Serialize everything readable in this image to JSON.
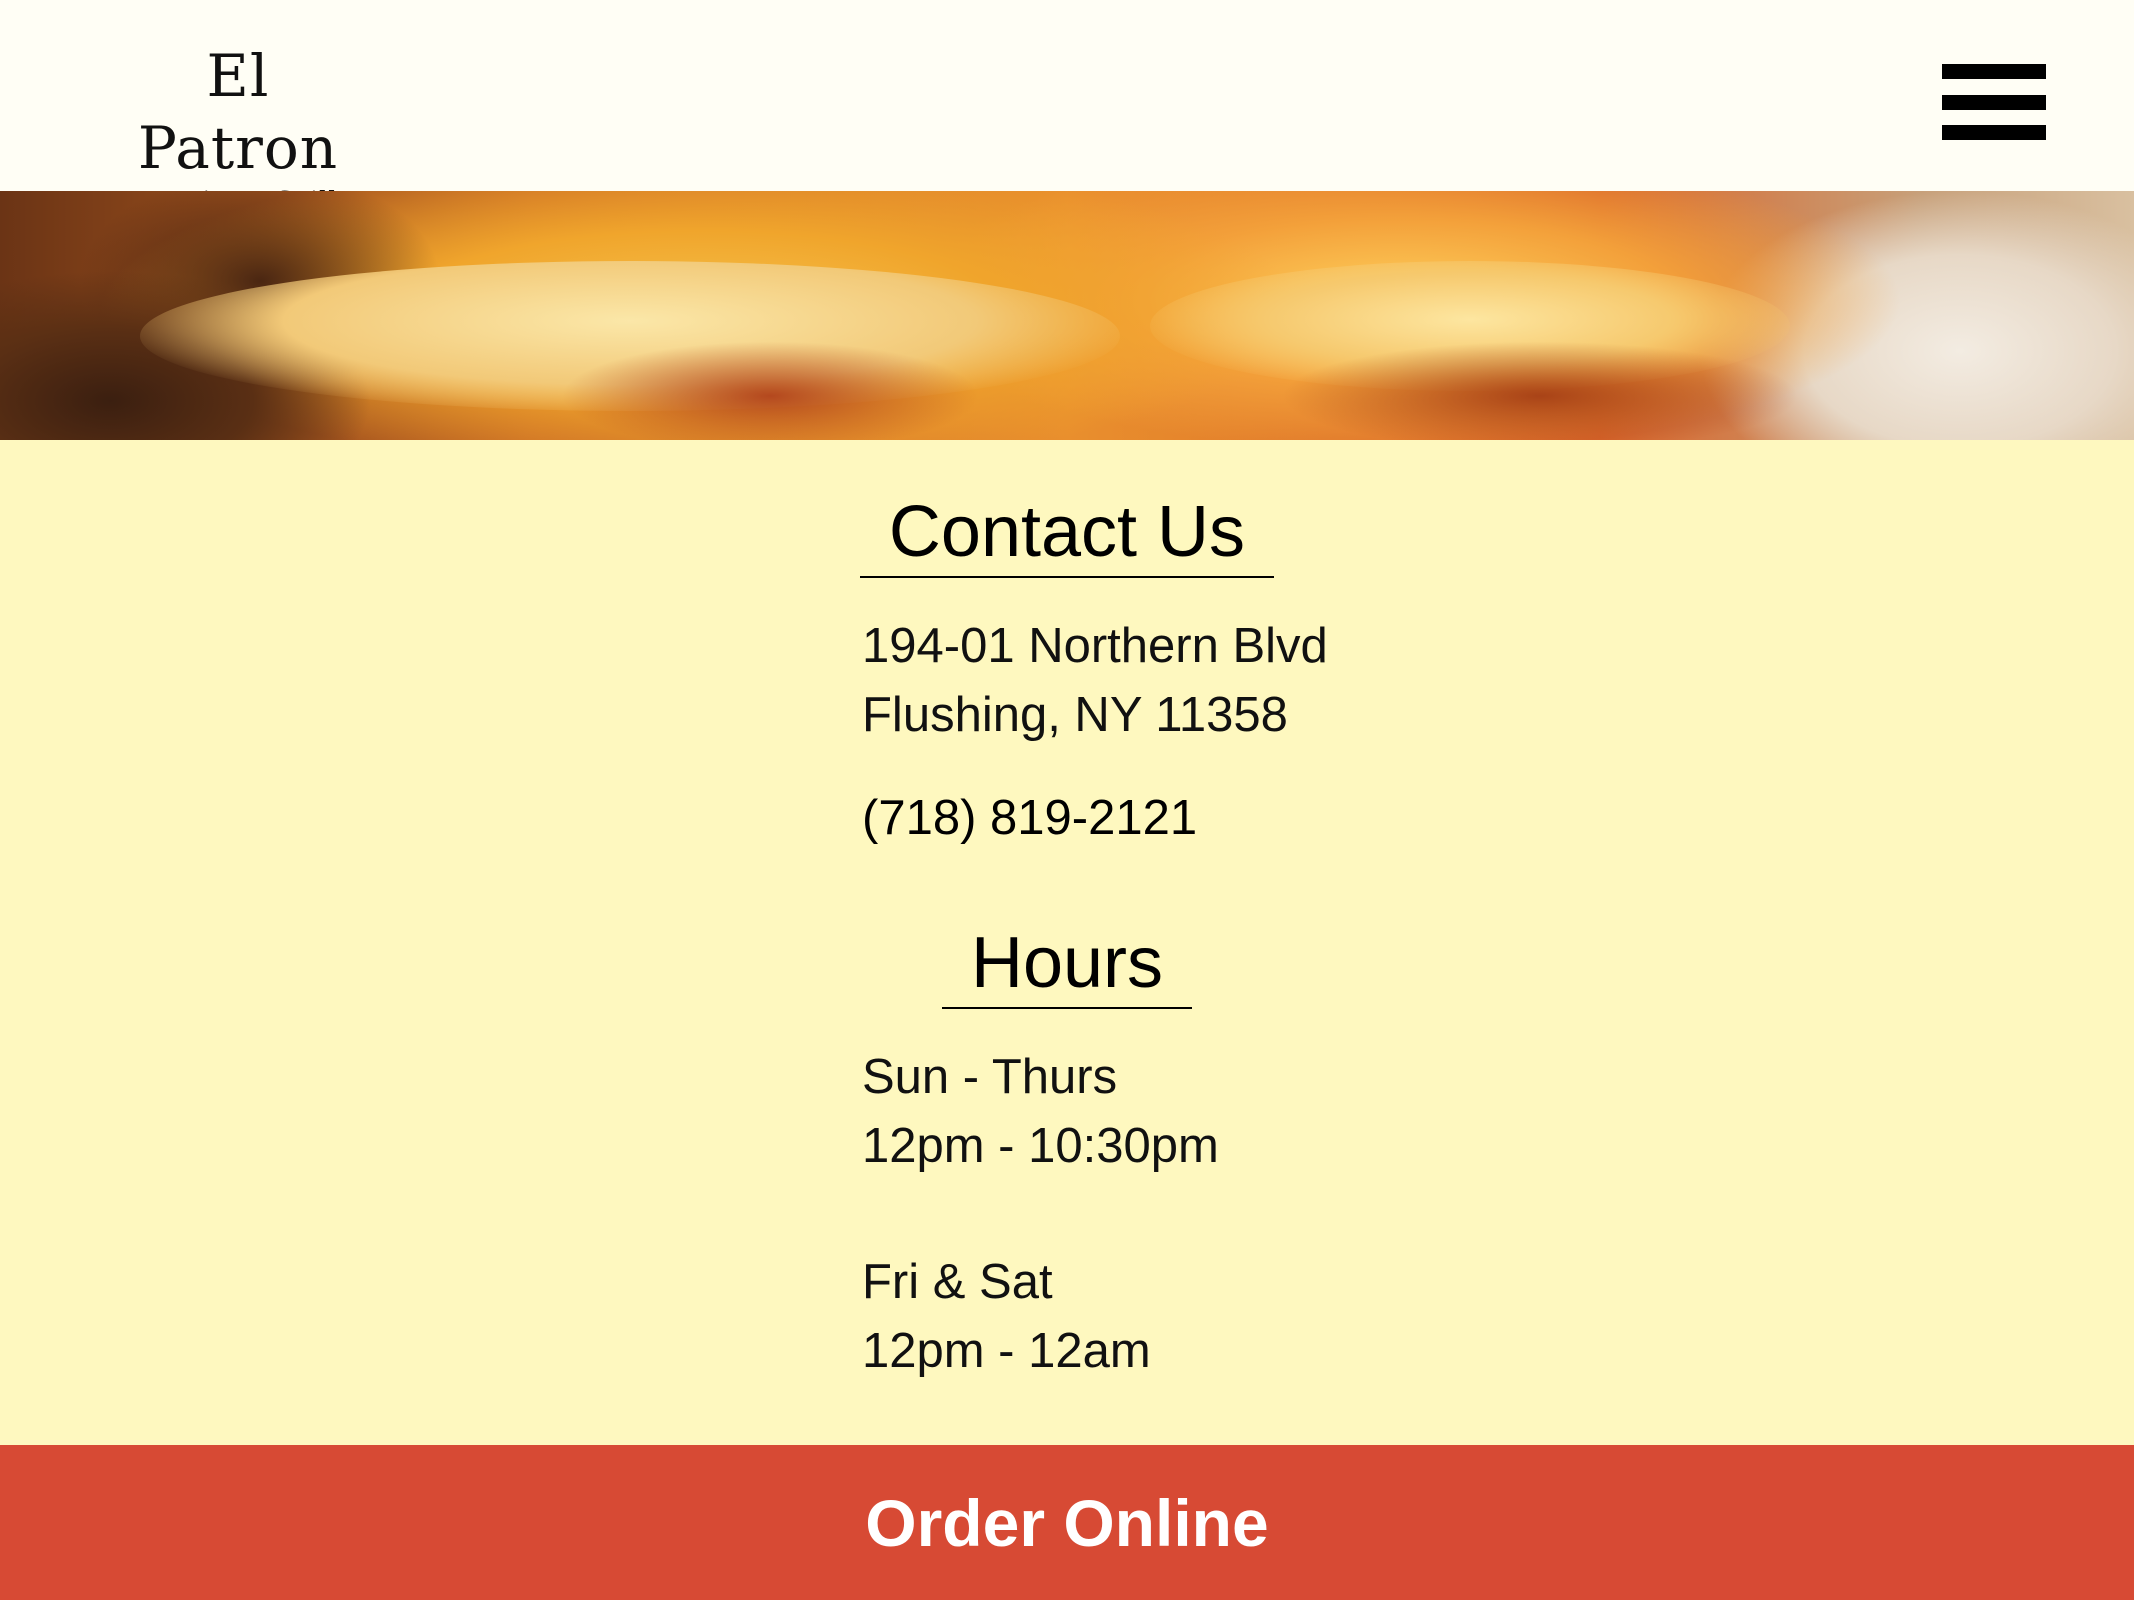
{
  "header": {
    "logo_name": "El Patron",
    "logo_sub": "Mexican Grill",
    "menu_icon": "hamburger-menu-icon"
  },
  "hero": {
    "image_subject": "enchiladas with melted cheese and beans"
  },
  "contact": {
    "title": "Contact Us",
    "address_line1": "194-01 Northern Blvd",
    "address_line2": "Flushing, NY 11358",
    "phone": "(718) 819-2121"
  },
  "hours": {
    "title": "Hours",
    "group1_days": "Sun - Thurs",
    "group1_time": "12pm - 10:30pm",
    "group2_days": "Fri & Sat",
    "group2_time": "12pm - 12am"
  },
  "footer": {
    "order_label": "Order Online"
  },
  "colors": {
    "header_bg": "#fffef5",
    "page_bg": "#fef8bf",
    "order_bar": "#d74a34",
    "text": "#000000"
  }
}
